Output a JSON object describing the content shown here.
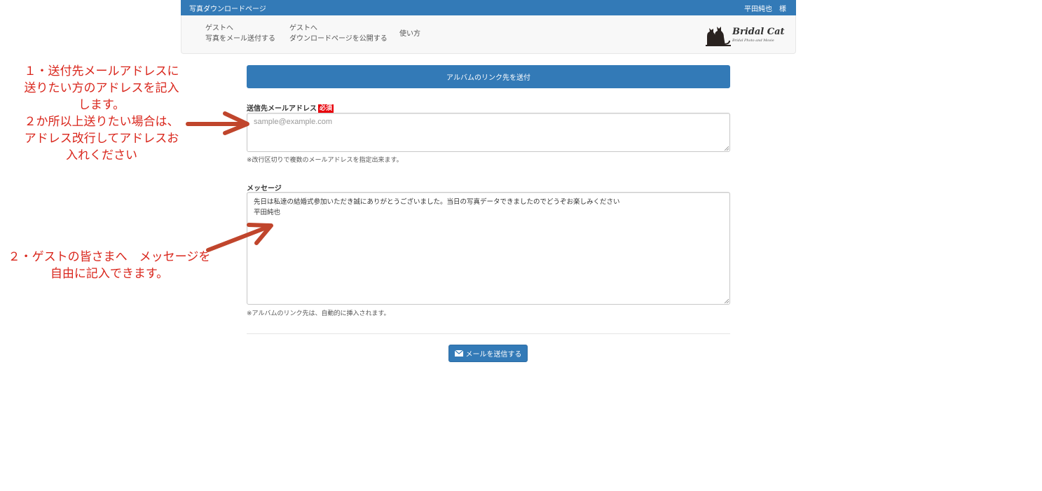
{
  "header": {
    "title": "写真ダウンロードページ",
    "user": "平田純也　様"
  },
  "nav": {
    "items": [
      {
        "line1": "ゲストへ",
        "line2": "写真をメール送付する"
      },
      {
        "line1": "ゲストへ",
        "line2": "ダウンロードページを公開する"
      },
      {
        "line1": "使い方",
        "line2": ""
      }
    ],
    "logo": {
      "title": "Bridal Cat",
      "subtitle": "Bridal Photo and Movie"
    }
  },
  "form": {
    "album_button": "アルバムのリンク先を送付",
    "email_label": "送信先メールアドレス",
    "required_badge": "必須",
    "email_placeholder": "sample@example.com",
    "email_help": "※改行区切りで複数のメールアドレスを指定出来ます。",
    "message_label": "メッセージ",
    "message_value": "先日は私達の結婚式参加いただき誠にありがとうございました。当日の写真データできましたのでどうぞお楽しみください\n平田純也",
    "message_help": "※アルバムのリンク先は、自動的に挿入されます。",
    "send_button": "メールを送信する"
  },
  "annotations": {
    "note1": [
      "１・送付先メールアドレスに",
      "送りたい方のアドレスを記入",
      "します。",
      "２か所以上送りたい場合は、",
      "アドレス改行してアドレスお",
      "入れください"
    ],
    "note2": [
      "２・ゲストの皆さまへ　メッセージを",
      "自由に記入できます。"
    ]
  },
  "colors": {
    "primary": "#337ab7",
    "annotation": "#d9261c",
    "arrow": "#c0452c",
    "required": "#e8000a"
  }
}
